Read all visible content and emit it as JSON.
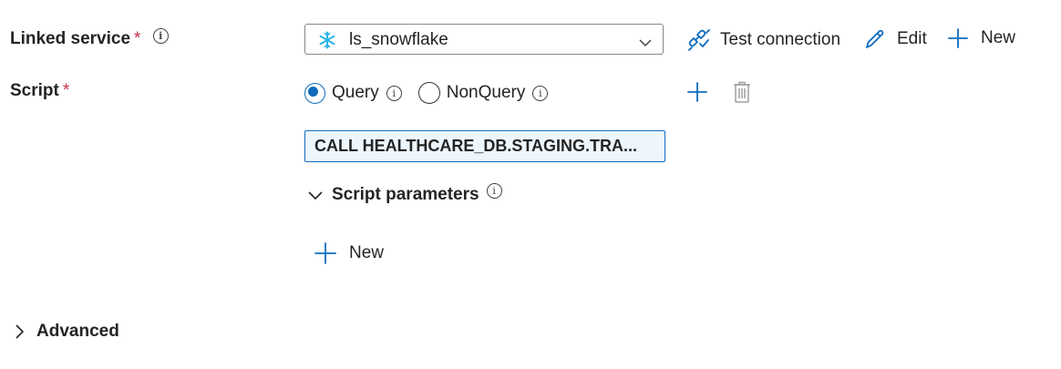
{
  "linked_service": {
    "label": "Linked service",
    "required_mark": "*",
    "selected": "ls_snowflake",
    "icon": "snowflake-icon",
    "actions": {
      "test_connection": "Test connection",
      "edit": "Edit",
      "new": "New"
    }
  },
  "script": {
    "label": "Script",
    "required_mark": "*",
    "types": [
      {
        "label": "Query",
        "checked": true
      },
      {
        "label": "NonQuery",
        "checked": false
      }
    ],
    "value": "CALL HEALTHCARE_DB.STAGING.TRA...",
    "parameters_label": "Script parameters",
    "new_parameter": "New"
  },
  "advanced": {
    "label": "Advanced"
  },
  "colors": {
    "accent": "#0f6cbd",
    "required": "#c4314b",
    "disabled": "#a19f9d"
  }
}
